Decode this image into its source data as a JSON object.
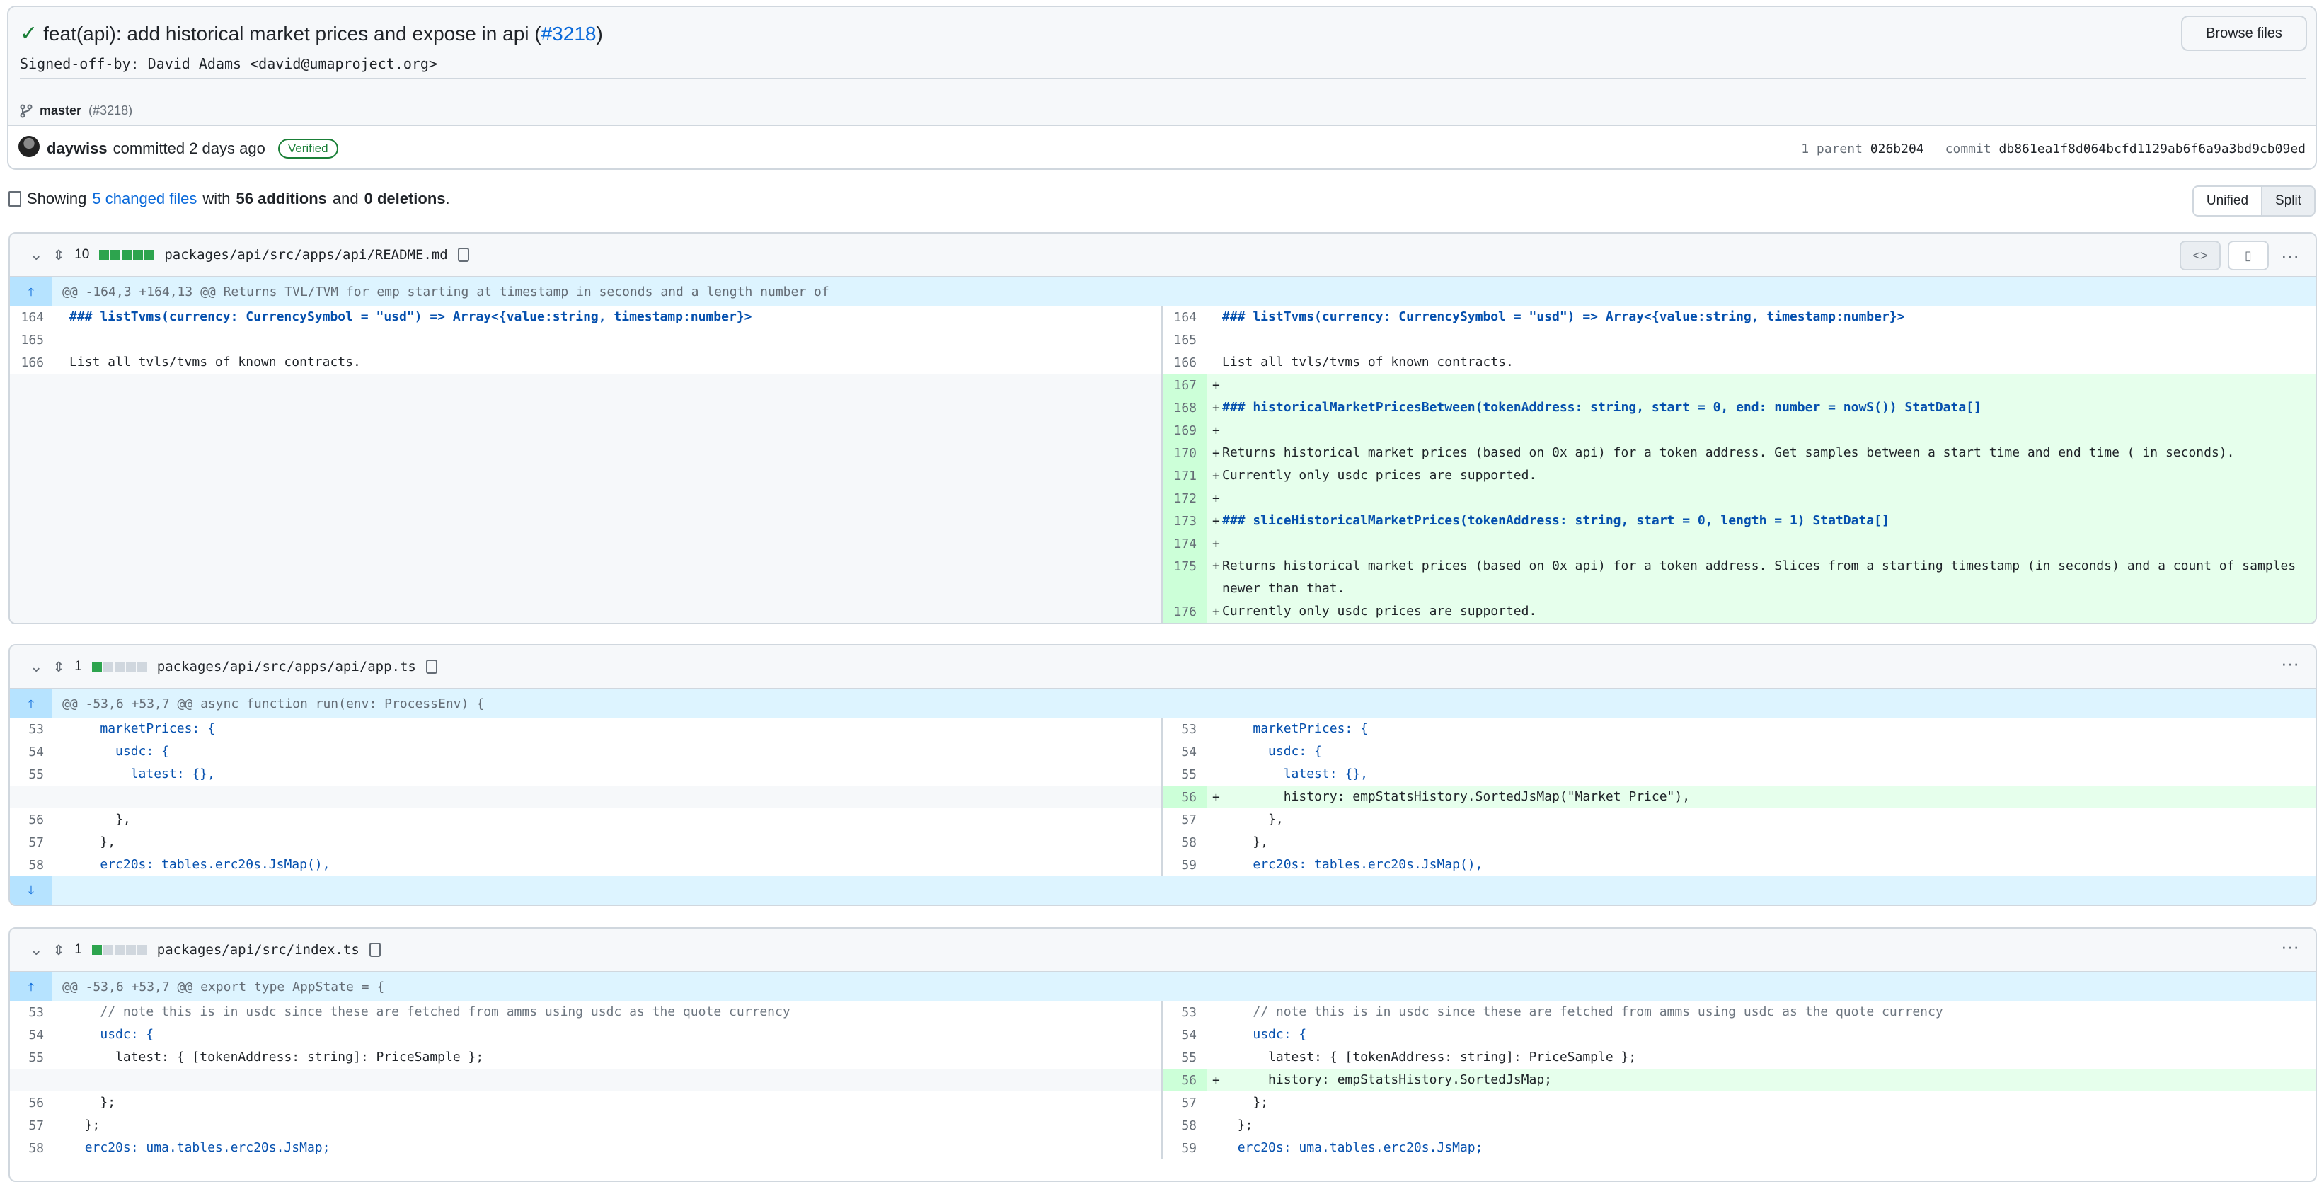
{
  "commit": {
    "title": "feat(api): add historical market prices and expose in api",
    "pr_link": "#3218",
    "signoff": "Signed-off-by: David Adams <david@umaproject.org>",
    "browse_label": "Browse files",
    "branch": "master",
    "branch_pr": "(#3218)",
    "author": "daywiss",
    "committed_text": "committed 2 days ago",
    "verified": "Verified",
    "parent_label": "1 parent",
    "parent_sha": "026b204",
    "commit_label": "commit",
    "commit_sha": "db861ea1f8d064bcfd1129ab6f6a9a3bd9cb09ed"
  },
  "summary": {
    "showing": "Showing",
    "changed_files": "5 changed files",
    "with": "with",
    "additions": "56 additions",
    "and": "and",
    "deletions": "0 deletions",
    "period": "."
  },
  "view_toggle": {
    "unified": "Unified",
    "split": "Split"
  },
  "files": [
    {
      "count": "10",
      "name": "packages/api/src/apps/api/README.md",
      "hunk": "@@ -164,3 +164,13 @@ Returns TVL/TVM for emp starting at timestamp in seconds and a length number of"
    },
    {
      "count": "1",
      "name": "packages/api/src/apps/api/app.ts",
      "hunk": "@@ -53,6 +53,7 @@ async function run(env: ProcessEnv) {"
    },
    {
      "count": "1",
      "name": "packages/api/src/index.ts",
      "hunk": "@@ -53,6 +53,7 @@ export type AppState = {"
    }
  ],
  "readme": {
    "left": [
      {
        "n": "164",
        "t": "### listTvms(currency: CurrencySymbol = \"usd\") => Array<{value:string, timestamp:number}>"
      },
      {
        "n": "165",
        "t": ""
      },
      {
        "n": "166",
        "t": "List all tvls/tvms of known contracts."
      }
    ],
    "right": [
      {
        "n": "164",
        "t": "### listTvms(currency: CurrencySymbol = \"usd\") => Array<{value:string, timestamp:number}>"
      },
      {
        "n": "165",
        "t": ""
      },
      {
        "n": "166",
        "t": "List all tvls/tvms of known contracts."
      },
      {
        "n": "167",
        "t": ""
      },
      {
        "n": "168",
        "t": "### historicalMarketPricesBetween(tokenAddress: string, start = 0, end: number = nowS()) StatData[]"
      },
      {
        "n": "169",
        "t": ""
      },
      {
        "n": "170",
        "t": "Returns historical market prices (based on 0x api) for a token address. Get samples between a start time and end time ( in seconds)."
      },
      {
        "n": "171",
        "t": "Currently only usdc prices are supported."
      },
      {
        "n": "172",
        "t": ""
      },
      {
        "n": "173",
        "t": "### sliceHistoricalMarketPrices(tokenAddress: string, start = 0, length = 1) StatData[]"
      },
      {
        "n": "174",
        "t": ""
      },
      {
        "n": "175",
        "t": "Returns historical market prices (based on 0x api) for a token address. Slices from a starting timestamp (in seconds) and a count of samples newer than that."
      },
      {
        "n": "176",
        "t": "Currently only usdc prices are supported."
      }
    ]
  },
  "appts": {
    "left": [
      {
        "n": "53",
        "t": "    marketPrices: {"
      },
      {
        "n": "54",
        "t": "      usdc: {"
      },
      {
        "n": "55",
        "t": "        latest: {},"
      },
      {
        "n": "56",
        "t": "      },"
      },
      {
        "n": "57",
        "t": "    },"
      },
      {
        "n": "58",
        "t": "    erc20s: tables.erc20s.JsMap(),"
      }
    ],
    "right": [
      {
        "n": "53",
        "t": "    marketPrices: {"
      },
      {
        "n": "54",
        "t": "      usdc: {"
      },
      {
        "n": "55",
        "t": "        latest: {},"
      },
      {
        "n": "56",
        "t": "        history: empStatsHistory.SortedJsMap(\"Market Price\"),"
      },
      {
        "n": "57",
        "t": "      },"
      },
      {
        "n": "58",
        "t": "    },"
      },
      {
        "n": "59",
        "t": "    erc20s: tables.erc20s.JsMap(),"
      }
    ]
  },
  "indexts": {
    "left": [
      {
        "n": "53",
        "t": "    // note this is in usdc since these are fetched from amms using usdc as the quote currency"
      },
      {
        "n": "54",
        "t": "    usdc: {"
      },
      {
        "n": "55",
        "t": "      latest: { [tokenAddress: string]: PriceSample };"
      },
      {
        "n": "56",
        "t": "    };"
      },
      {
        "n": "57",
        "t": "  };"
      },
      {
        "n": "58",
        "t": "  erc20s: uma.tables.erc20s.JsMap;"
      }
    ],
    "right": [
      {
        "n": "53",
        "t": "    // note this is in usdc since these are fetched from amms using usdc as the quote currency"
      },
      {
        "n": "54",
        "t": "    usdc: {"
      },
      {
        "n": "55",
        "t": "      latest: { [tokenAddress: string]: PriceSample };"
      },
      {
        "n": "56",
        "t": "      history: empStatsHistory.SortedJsMap;"
      },
      {
        "n": "57",
        "t": "    };"
      },
      {
        "n": "58",
        "t": "  };"
      },
      {
        "n": "59",
        "t": "  erc20s: uma.tables.erc20s.JsMap;"
      }
    ]
  }
}
